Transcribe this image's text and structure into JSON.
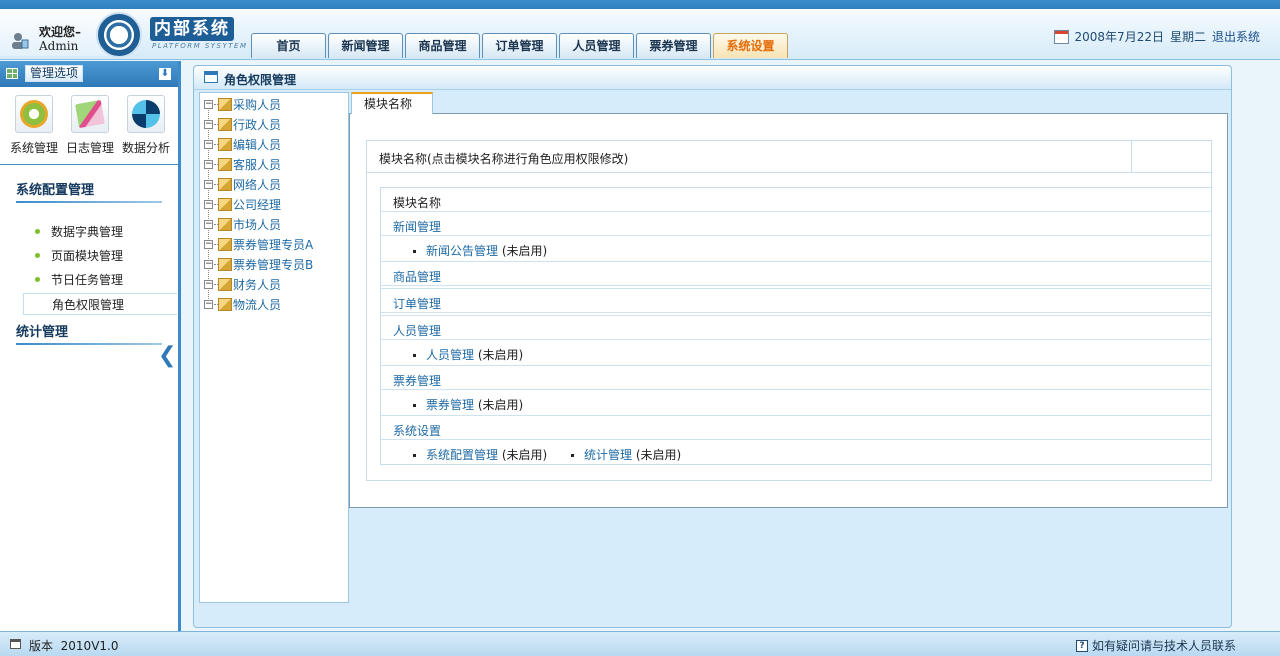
{
  "header": {
    "welcome": "欢迎您–",
    "username": "Admin",
    "logo_title": "内部系统",
    "logo_subtitle": "PLATFORM SYSYTEM",
    "tabs": [
      {
        "label": "首页",
        "active": false
      },
      {
        "label": "新闻管理",
        "active": false
      },
      {
        "label": "商品管理",
        "active": false
      },
      {
        "label": "订单管理",
        "active": false
      },
      {
        "label": "人员管理",
        "active": false
      },
      {
        "label": "票券管理",
        "active": false
      },
      {
        "label": "系统设置",
        "active": true
      }
    ],
    "date": "2008年7月22日",
    "weekday": "星期二",
    "logout": "退出系统",
    "accent_color": "#e46c0a"
  },
  "sidebar": {
    "title": "管理选项",
    "quick_icons": [
      {
        "label": "系统管理",
        "icon": "gear-icon"
      },
      {
        "label": "日志管理",
        "icon": "log-icon"
      },
      {
        "label": "数据分析",
        "icon": "chart-icon"
      }
    ],
    "section1_title": "系统配置管理",
    "items": [
      {
        "label": "数据字典管理",
        "active": false
      },
      {
        "label": "页面模块管理",
        "active": false
      },
      {
        "label": "节日任务管理",
        "active": false
      },
      {
        "label": "角色权限管理",
        "active": true
      }
    ],
    "section2_title": "统计管理"
  },
  "main": {
    "title": "角色权限管理",
    "roles": [
      "采购人员",
      "行政人员",
      "编辑人员",
      "客服人员",
      "网络人员",
      "公司经理",
      "市场人员",
      "票券管理专员A",
      "票券管理专员B",
      "财务人员",
      "物流人员"
    ],
    "tab_label": "模块名称",
    "table_header": "模块名称(点击模块名称进行角色应用权限修改)",
    "inner_header": "模块名称",
    "groups": {
      "news": {
        "name": "新闻管理",
        "items": [
          {
            "link": "新闻公告管理",
            "status": "(未启用)"
          }
        ]
      },
      "goods": {
        "name": "商品管理"
      },
      "orders": {
        "name": "订单管理"
      },
      "staff": {
        "name": "人员管理",
        "items": [
          {
            "link": "人员管理",
            "status": "(未启用)"
          }
        ]
      },
      "tickets": {
        "name": "票券管理",
        "items": [
          {
            "link": "票券管理",
            "status": "(未启用)"
          }
        ]
      },
      "system": {
        "name": "系统设置",
        "items": [
          {
            "link": "系统配置管理",
            "status": "(未启用)"
          },
          {
            "link": "统计管理",
            "status": "(未启用)"
          }
        ]
      }
    }
  },
  "footer": {
    "version_label": "版本",
    "version": "2010V1.0",
    "help": "如有疑问请与技术人员联系"
  }
}
